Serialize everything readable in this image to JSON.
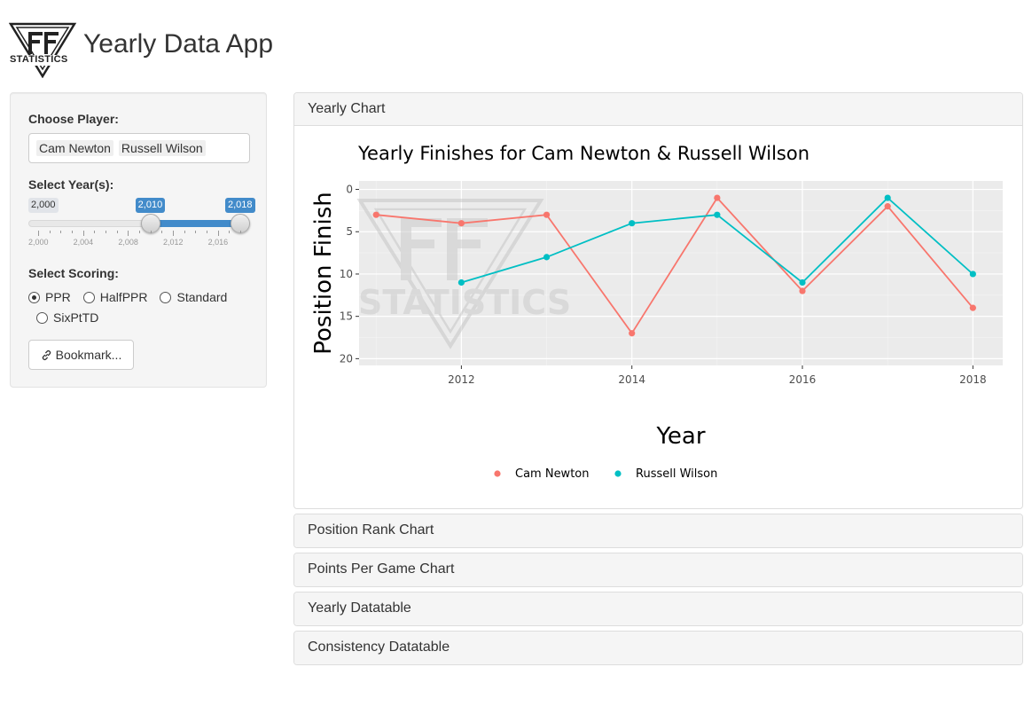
{
  "header": {
    "title": "Yearly Data App",
    "logo_text": "STATISTICS"
  },
  "sidebar": {
    "player_label": "Choose Player:",
    "players": [
      "Cam Newton",
      "Russell Wilson"
    ],
    "year_label": "Select Year(s):",
    "slider": {
      "min": 2000,
      "max": 2018,
      "from": 2010,
      "to": 2018,
      "min_label": "2,000",
      "from_label": "2,010",
      "to_label": "2,018",
      "tick_labels": [
        "2,000",
        "2,004",
        "2,008",
        "2,012",
        "2,016"
      ]
    },
    "scoring_label": "Select Scoring:",
    "scoring_options": [
      "PPR",
      "HalfPPR",
      "Standard",
      "SixPtTD"
    ],
    "scoring_selected": "PPR",
    "bookmark_label": "Bookmark..."
  },
  "panels": [
    {
      "title": "Yearly Chart",
      "expanded": true
    },
    {
      "title": "Position Rank Chart",
      "expanded": false
    },
    {
      "title": "Points Per Game Chart",
      "expanded": false
    },
    {
      "title": "Yearly Datatable",
      "expanded": false
    },
    {
      "title": "Consistency Datatable",
      "expanded": false
    }
  ],
  "chart_data": {
    "type": "line",
    "title": "Yearly Finishes for Cam Newton & Russell Wilson",
    "xlabel": "Year",
    "ylabel": "Position Finish",
    "xlim": [
      2010.8,
      2018.35
    ],
    "ylim": [
      0,
      20
    ],
    "y_reversed": true,
    "x_ticks": [
      2012,
      2014,
      2016,
      2018
    ],
    "y_ticks": [
      0,
      5,
      10,
      15,
      20
    ],
    "grid": true,
    "legend_position": "bottom",
    "watermark_text": "STATISTICS",
    "series": [
      {
        "name": "Cam Newton",
        "color": "#f8766d",
        "x": [
          2011,
          2012,
          2013,
          2014,
          2015,
          2016,
          2017,
          2018
        ],
        "y": [
          3,
          4,
          3,
          17,
          1,
          12,
          2,
          14
        ]
      },
      {
        "name": "Russell Wilson",
        "color": "#00bfc4",
        "x": [
          2012,
          2013,
          2014,
          2015,
          2016,
          2017,
          2018
        ],
        "y": [
          11,
          8,
          4,
          3,
          11,
          1,
          10
        ]
      }
    ]
  }
}
